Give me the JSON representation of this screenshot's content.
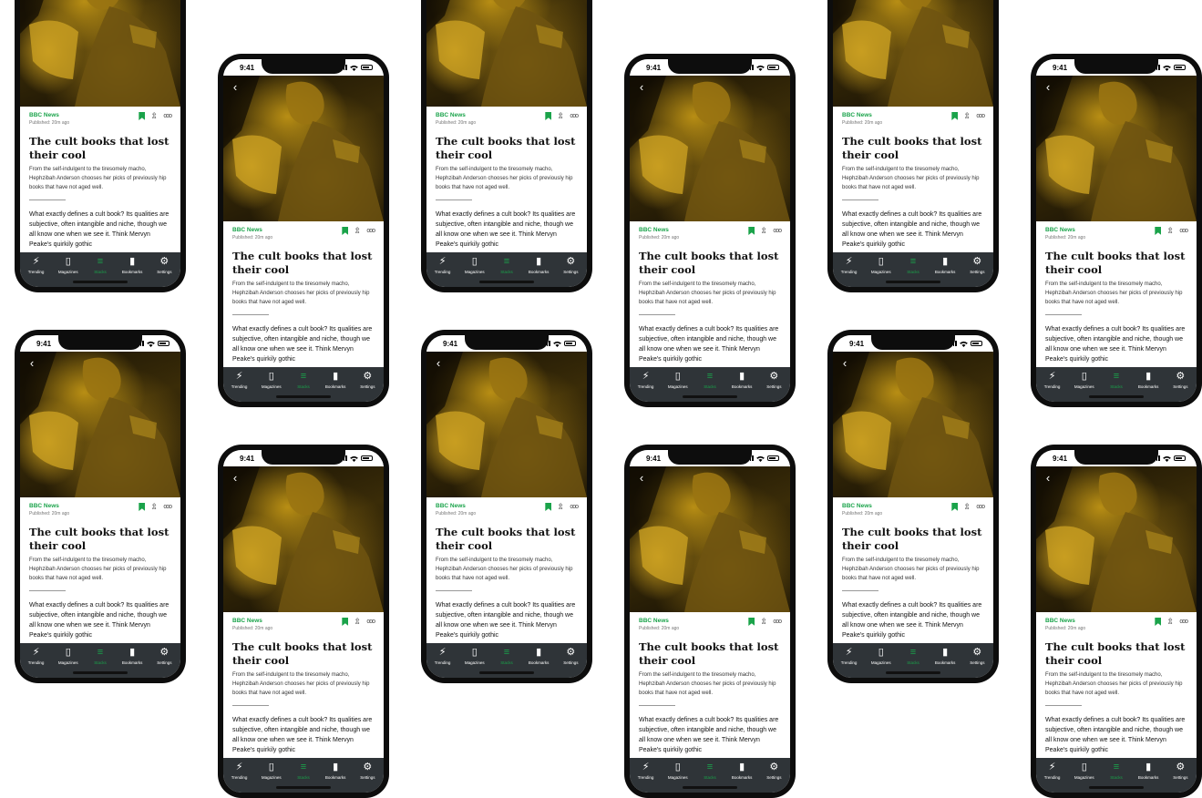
{
  "status": {
    "time": "9:41"
  },
  "article": {
    "source": "BBC News",
    "published": "Published: 20m ago",
    "headline": "The cult books that lost their cool",
    "standfirst": "From the self-indulgent to the tiresomely macho, Hephzibah Anderson chooses her picks of previously hip books that have not aged well.",
    "body": "What exactly defines a cult book? Its qualities are subjective, often intangible and niche, though we all know one when we see it. Think Mervyn Peake's quirkily gothic"
  },
  "icons": {
    "back": "chevron-left-icon",
    "bookmark": "bookmark-icon",
    "share": "share-icon",
    "more": "more-icon"
  },
  "tabs": [
    {
      "label": "Trending",
      "icon": "lightning-icon"
    },
    {
      "label": "Magazines",
      "icon": "magazines-icon"
    },
    {
      "label": "Stacks",
      "icon": "stacks-icon"
    },
    {
      "label": "Bookmarks",
      "icon": "bookmark-icon"
    },
    {
      "label": "Settings",
      "icon": "gear-icon"
    }
  ],
  "colors": {
    "accent": "#1aa34a",
    "tabbar": "#2f3438",
    "hero_tint": "#b88e14"
  }
}
